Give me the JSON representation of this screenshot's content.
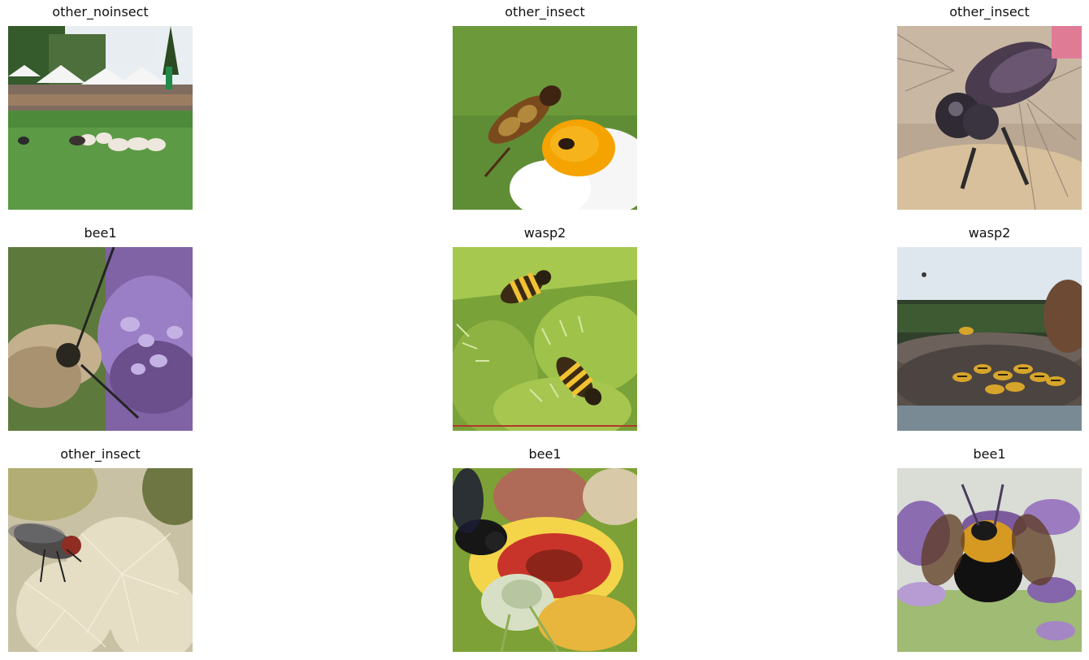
{
  "panels": [
    {
      "title": "other_noinsect"
    },
    {
      "title": "other_insect"
    },
    {
      "title": "other_insect"
    },
    {
      "title": "bee1"
    },
    {
      "title": "wasp2"
    },
    {
      "title": "wasp2"
    },
    {
      "title": "other_insect"
    },
    {
      "title": "bee1"
    },
    {
      "title": "bee1"
    }
  ]
}
